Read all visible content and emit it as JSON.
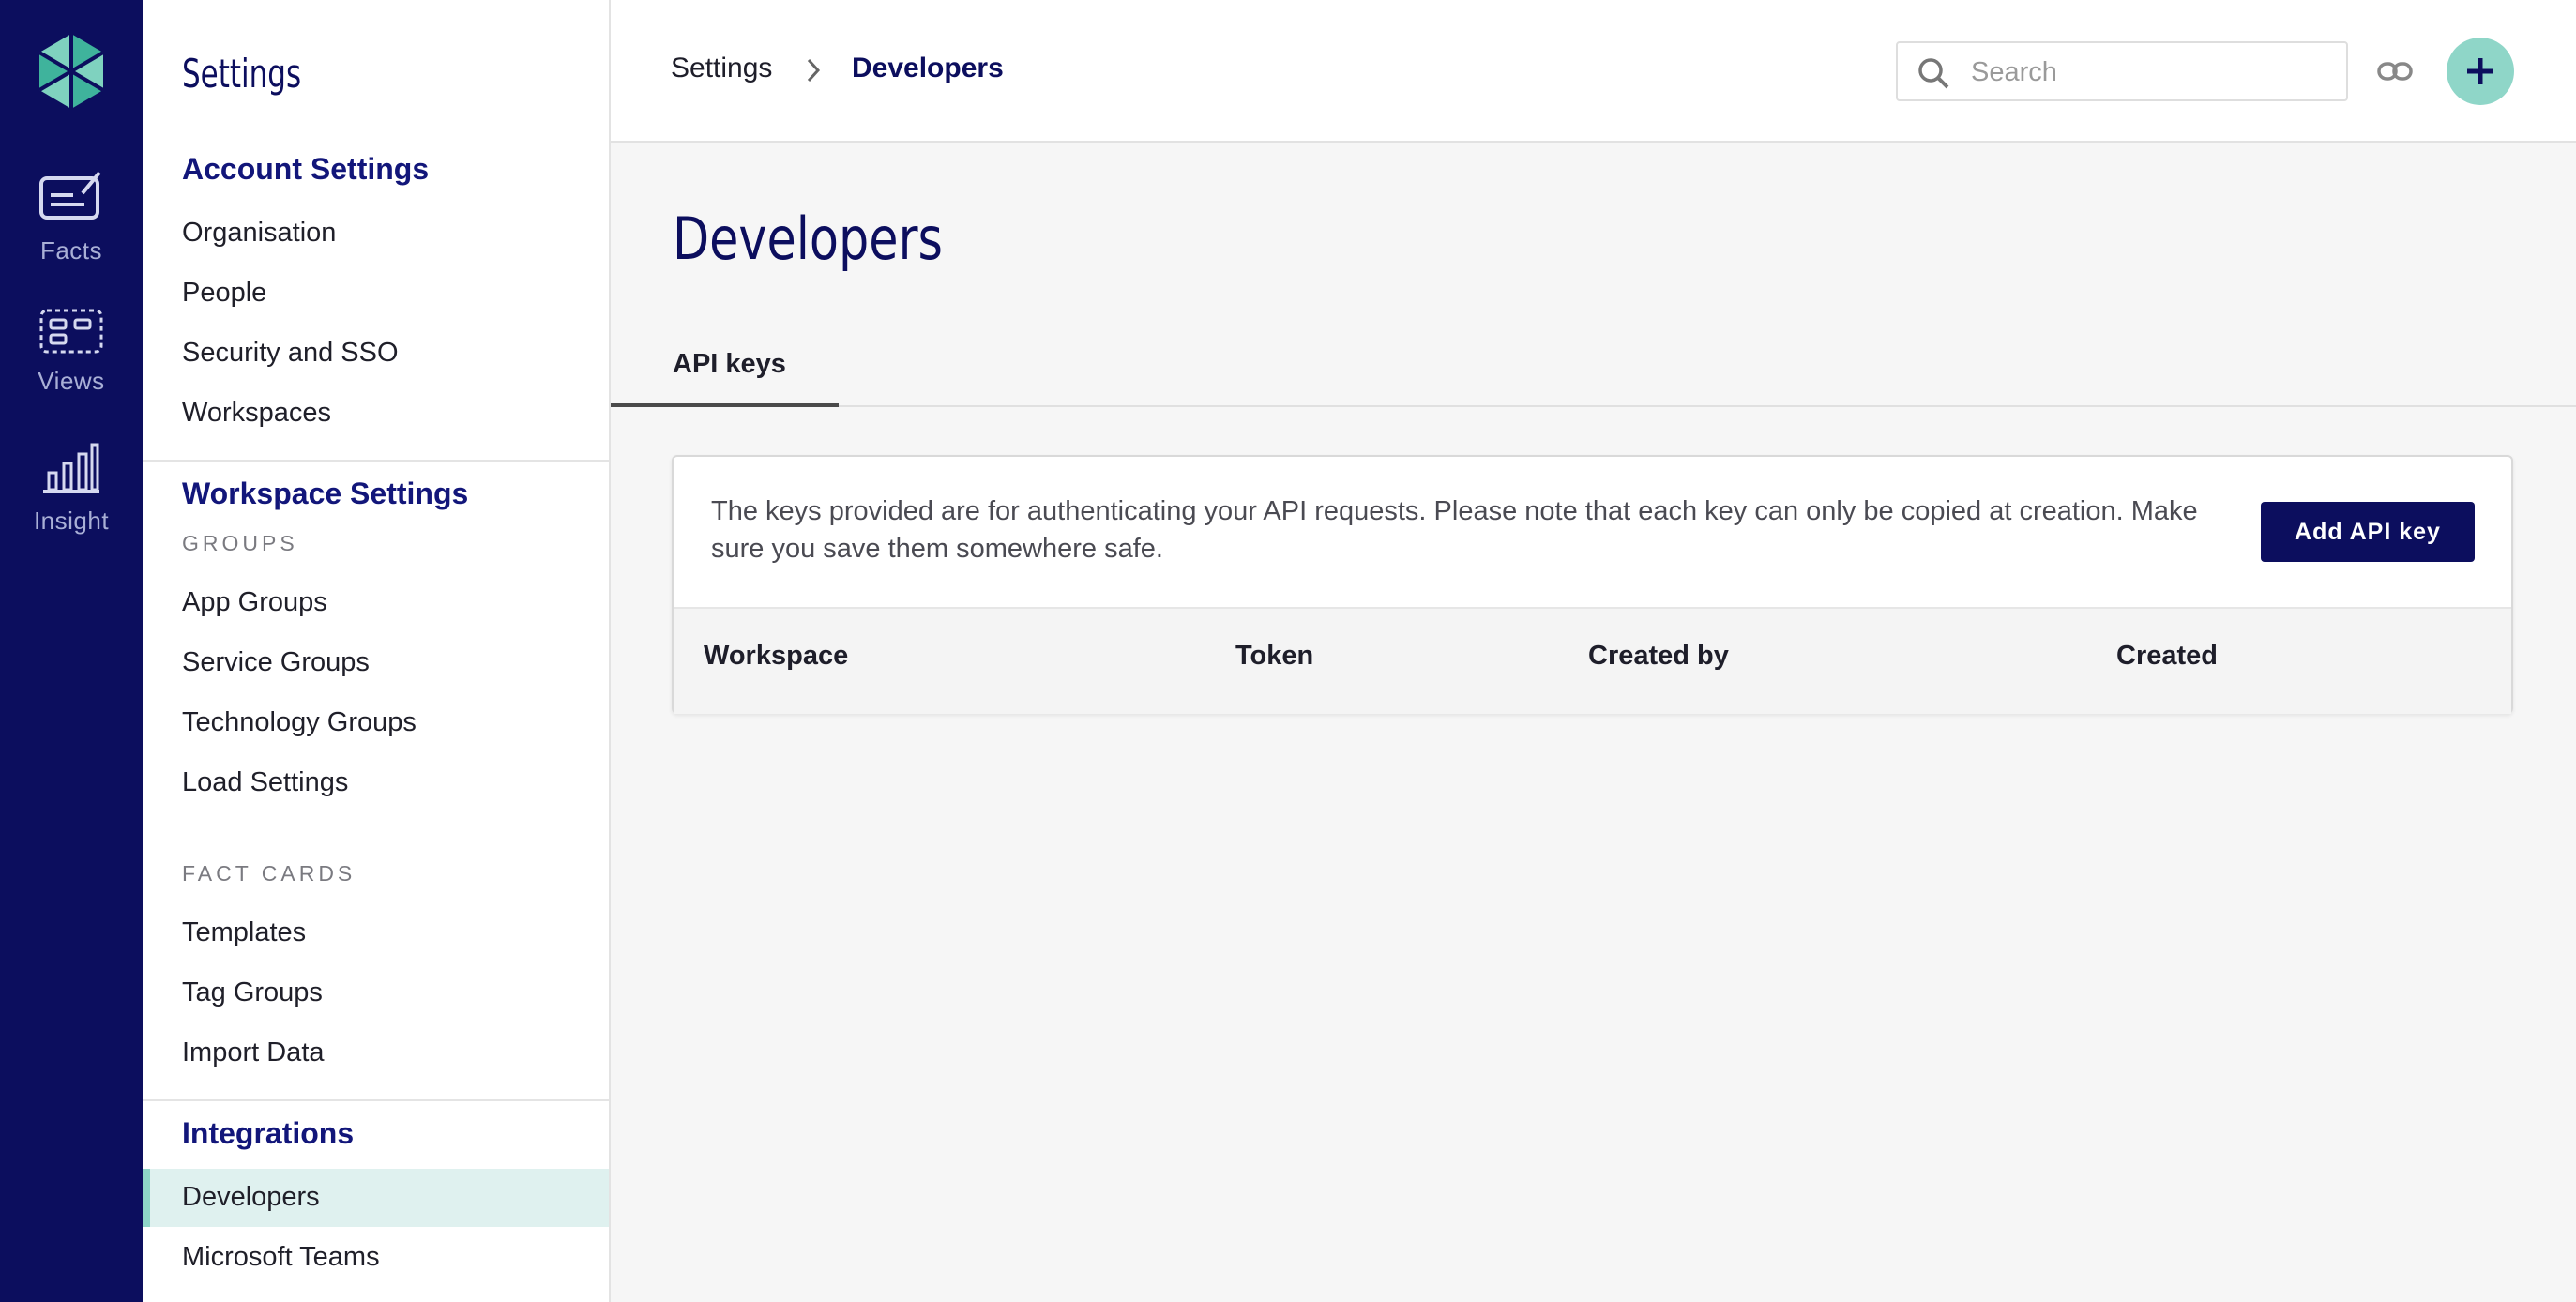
{
  "rail": {
    "items": [
      {
        "label": "Facts"
      },
      {
        "label": "Views"
      },
      {
        "label": "Insight"
      }
    ]
  },
  "sidebar": {
    "title": "Settings",
    "account": {
      "heading": "Account Settings",
      "items": [
        "Organisation",
        "People",
        "Security and SSO",
        "Workspaces"
      ]
    },
    "workspace": {
      "heading": "Workspace Settings",
      "groups_caption": "GROUPS",
      "groups": [
        "App Groups",
        "Service Groups",
        "Technology Groups",
        "Load Settings"
      ],
      "factcards_caption": "FACT CARDS",
      "factcards": [
        "Templates",
        "Tag Groups",
        "Import Data"
      ]
    },
    "integrations": {
      "heading": "Integrations",
      "items": [
        "Developers",
        "Microsoft Teams"
      ],
      "active": "Developers"
    }
  },
  "header": {
    "breadcrumb": [
      "Settings",
      "Developers"
    ],
    "search_placeholder": "Search",
    "search_value": ""
  },
  "main": {
    "title": "Developers",
    "tabs": [
      {
        "label": "API keys",
        "active": true
      }
    ],
    "card": {
      "description": "The keys provided are for authenticating your API requests. Please note that each key can only be copied at creation. Make sure you save them somewhere safe.",
      "add_button": "Add API key",
      "columns": [
        "Workspace",
        "Token",
        "Created by",
        "Created"
      ]
    }
  },
  "colors": {
    "navy": "#0c0e5e",
    "teal": "#8fd6c8",
    "active_bg": "#dff1ef"
  }
}
